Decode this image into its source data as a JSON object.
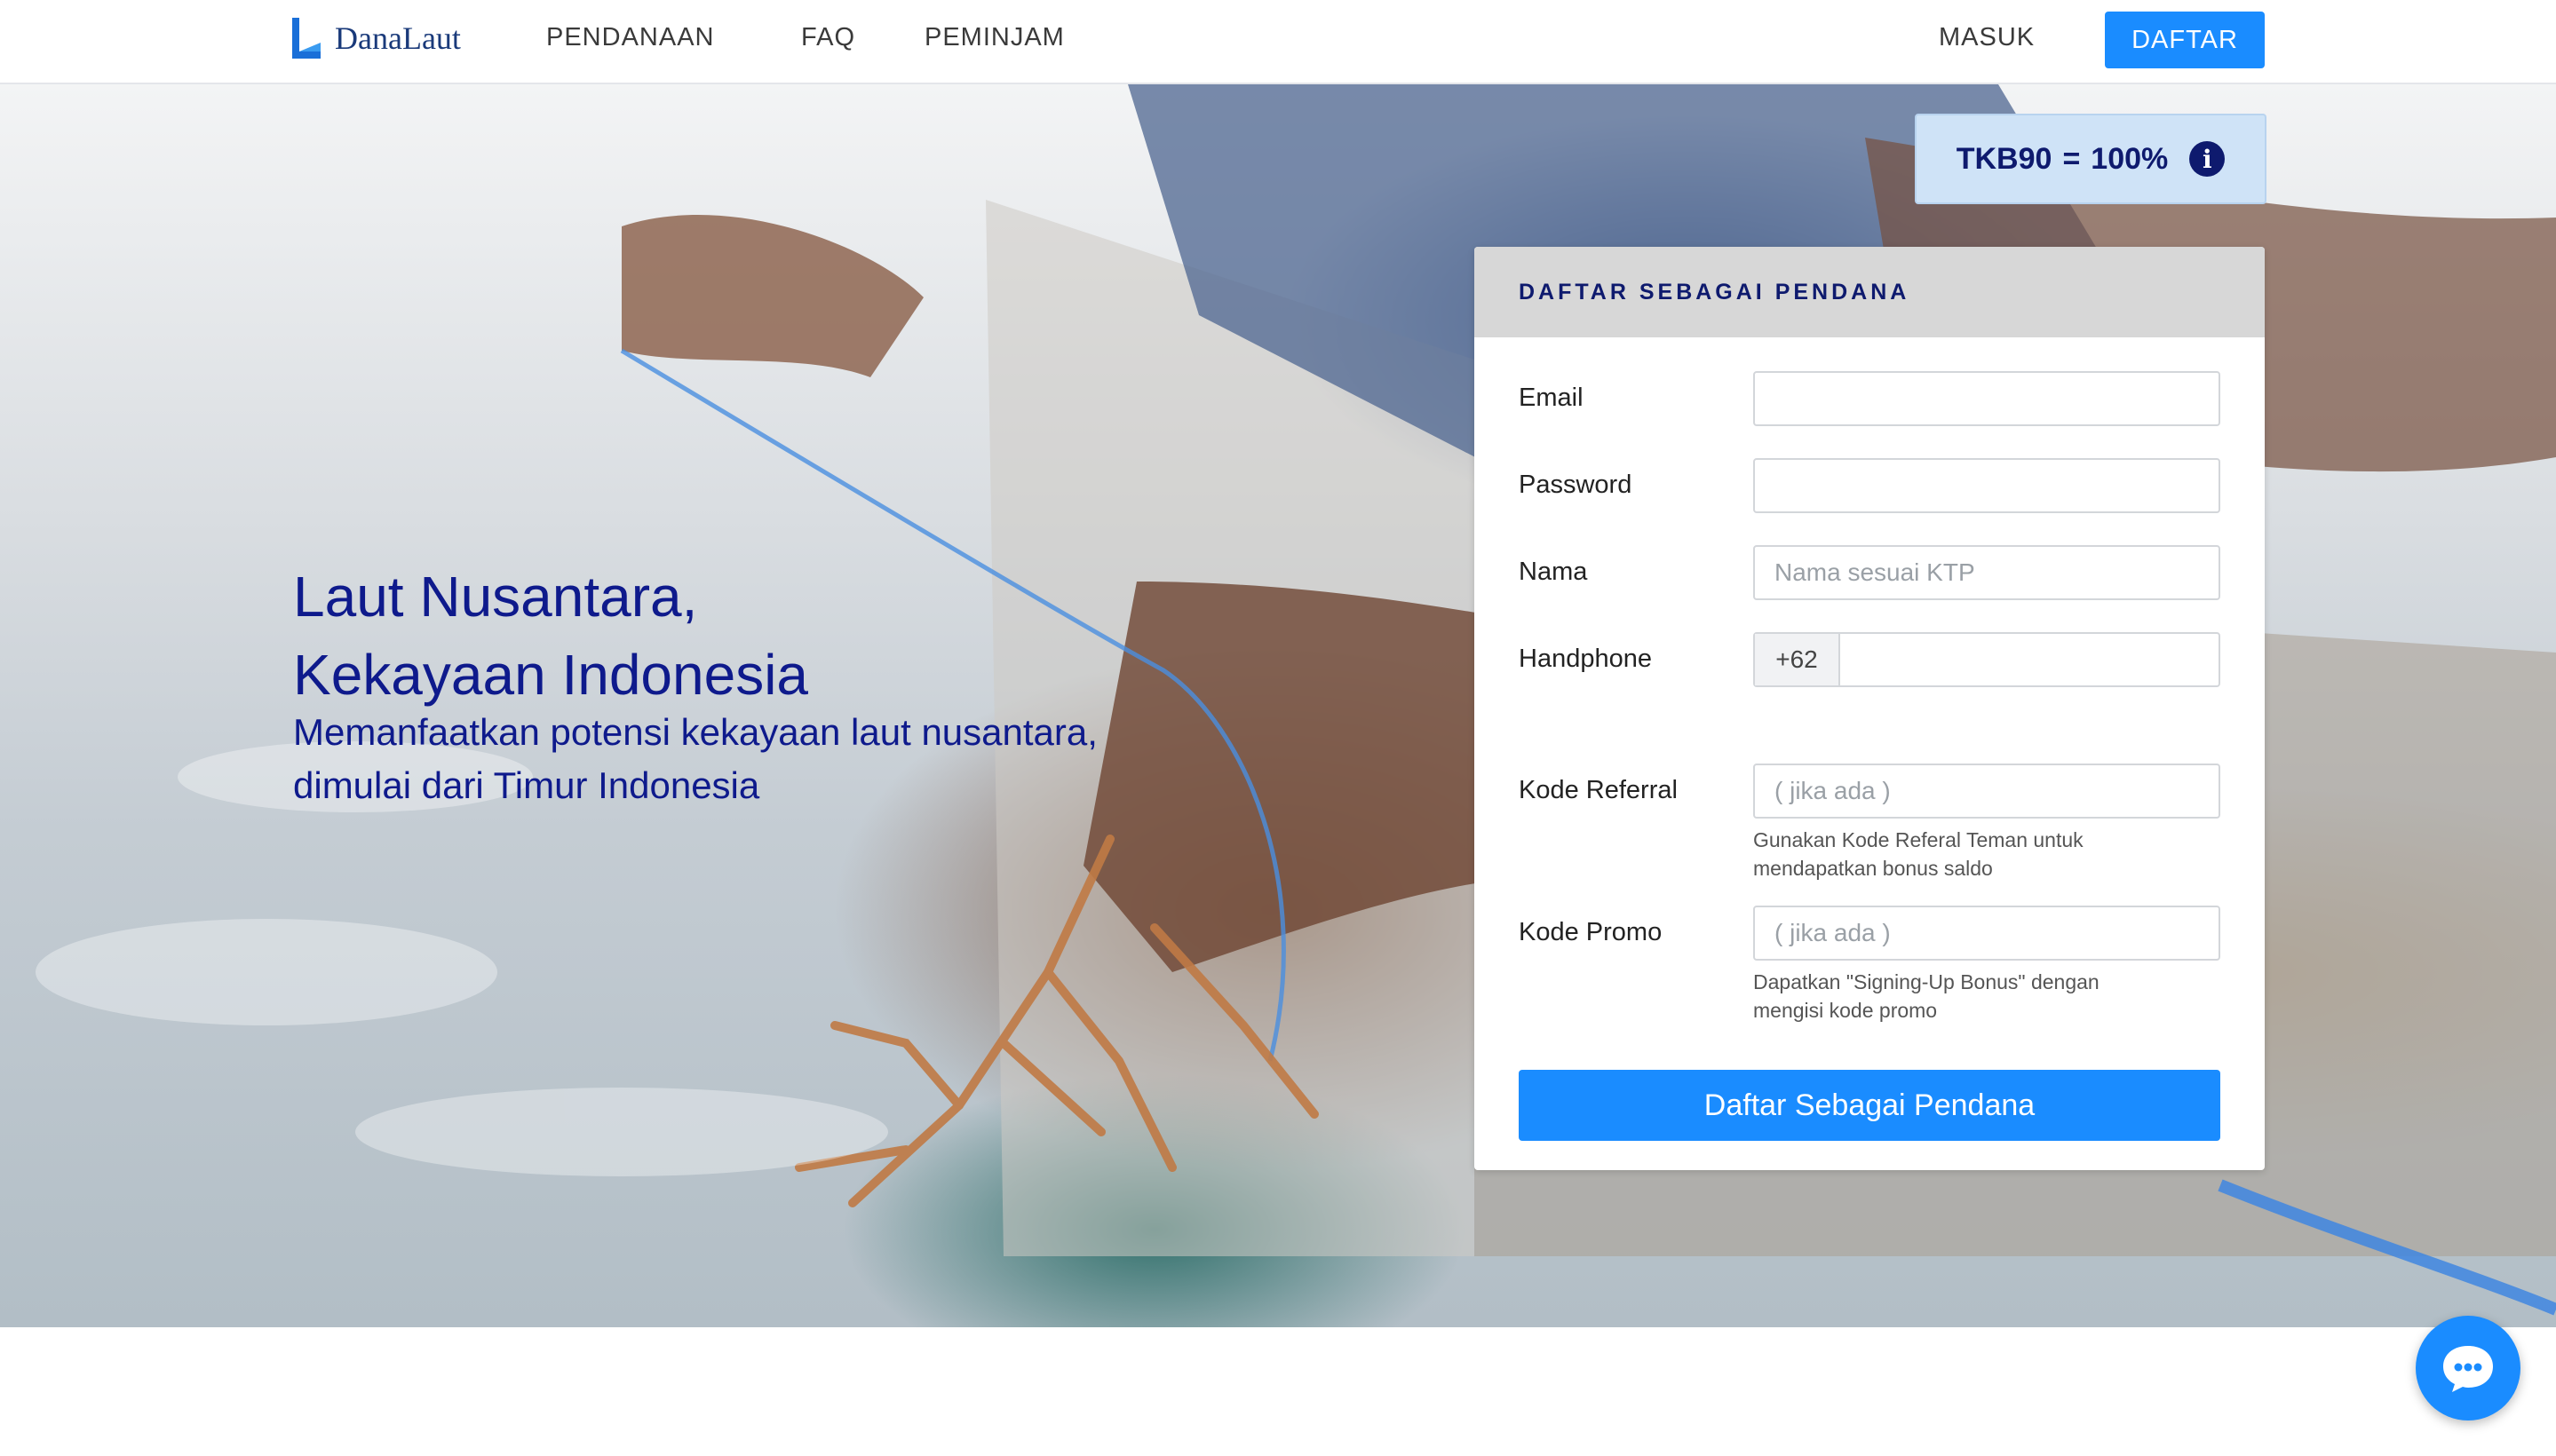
{
  "nav": {
    "logo_text": "DanaLaut",
    "links": [
      "PENDANAAN",
      "FAQ",
      "PEMINJAM"
    ],
    "login": "MASUK",
    "register": "DAFTAR"
  },
  "hero": {
    "title_lines": [
      "Laut Nusantara,",
      "Kekayaan Indonesia"
    ],
    "subtitle_lines": [
      "Memanfaatkan potensi kekayaan laut nusantara,",
      "dimulai dari Timur Indonesia"
    ]
  },
  "tkb": {
    "label": "TKB90",
    "equals": "=",
    "value": "100%",
    "icon": "info-icon"
  },
  "form": {
    "heading": "DAFTAR SEBAGAI PENDANA",
    "fields": {
      "email": {
        "label": "Email",
        "placeholder": ""
      },
      "password": {
        "label": "Password",
        "placeholder": ""
      },
      "nama": {
        "label": "Nama",
        "placeholder": "Nama sesuai KTP"
      },
      "handphone": {
        "label": "Handphone",
        "prefix": "+62",
        "placeholder": ""
      },
      "referral": {
        "label": "Kode Referral",
        "placeholder": "( jika ada )",
        "help_lines": [
          "Gunakan Kode Referal Teman untuk",
          "mendapatkan bonus saldo"
        ]
      },
      "promo": {
        "label": "Kode Promo",
        "placeholder": "( jika ada )",
        "help_lines": [
          "Dapatkan \"Signing-Up Bonus\" dengan",
          "mengisi kode promo"
        ]
      }
    },
    "submit": "Daftar Sebagai Pendana"
  },
  "chat": {
    "icon": "chat-bubble-icon"
  },
  "colors": {
    "accent": "#1a8cff",
    "navy": "#0e1a8c",
    "badge_bg": "#cfe3f7"
  }
}
